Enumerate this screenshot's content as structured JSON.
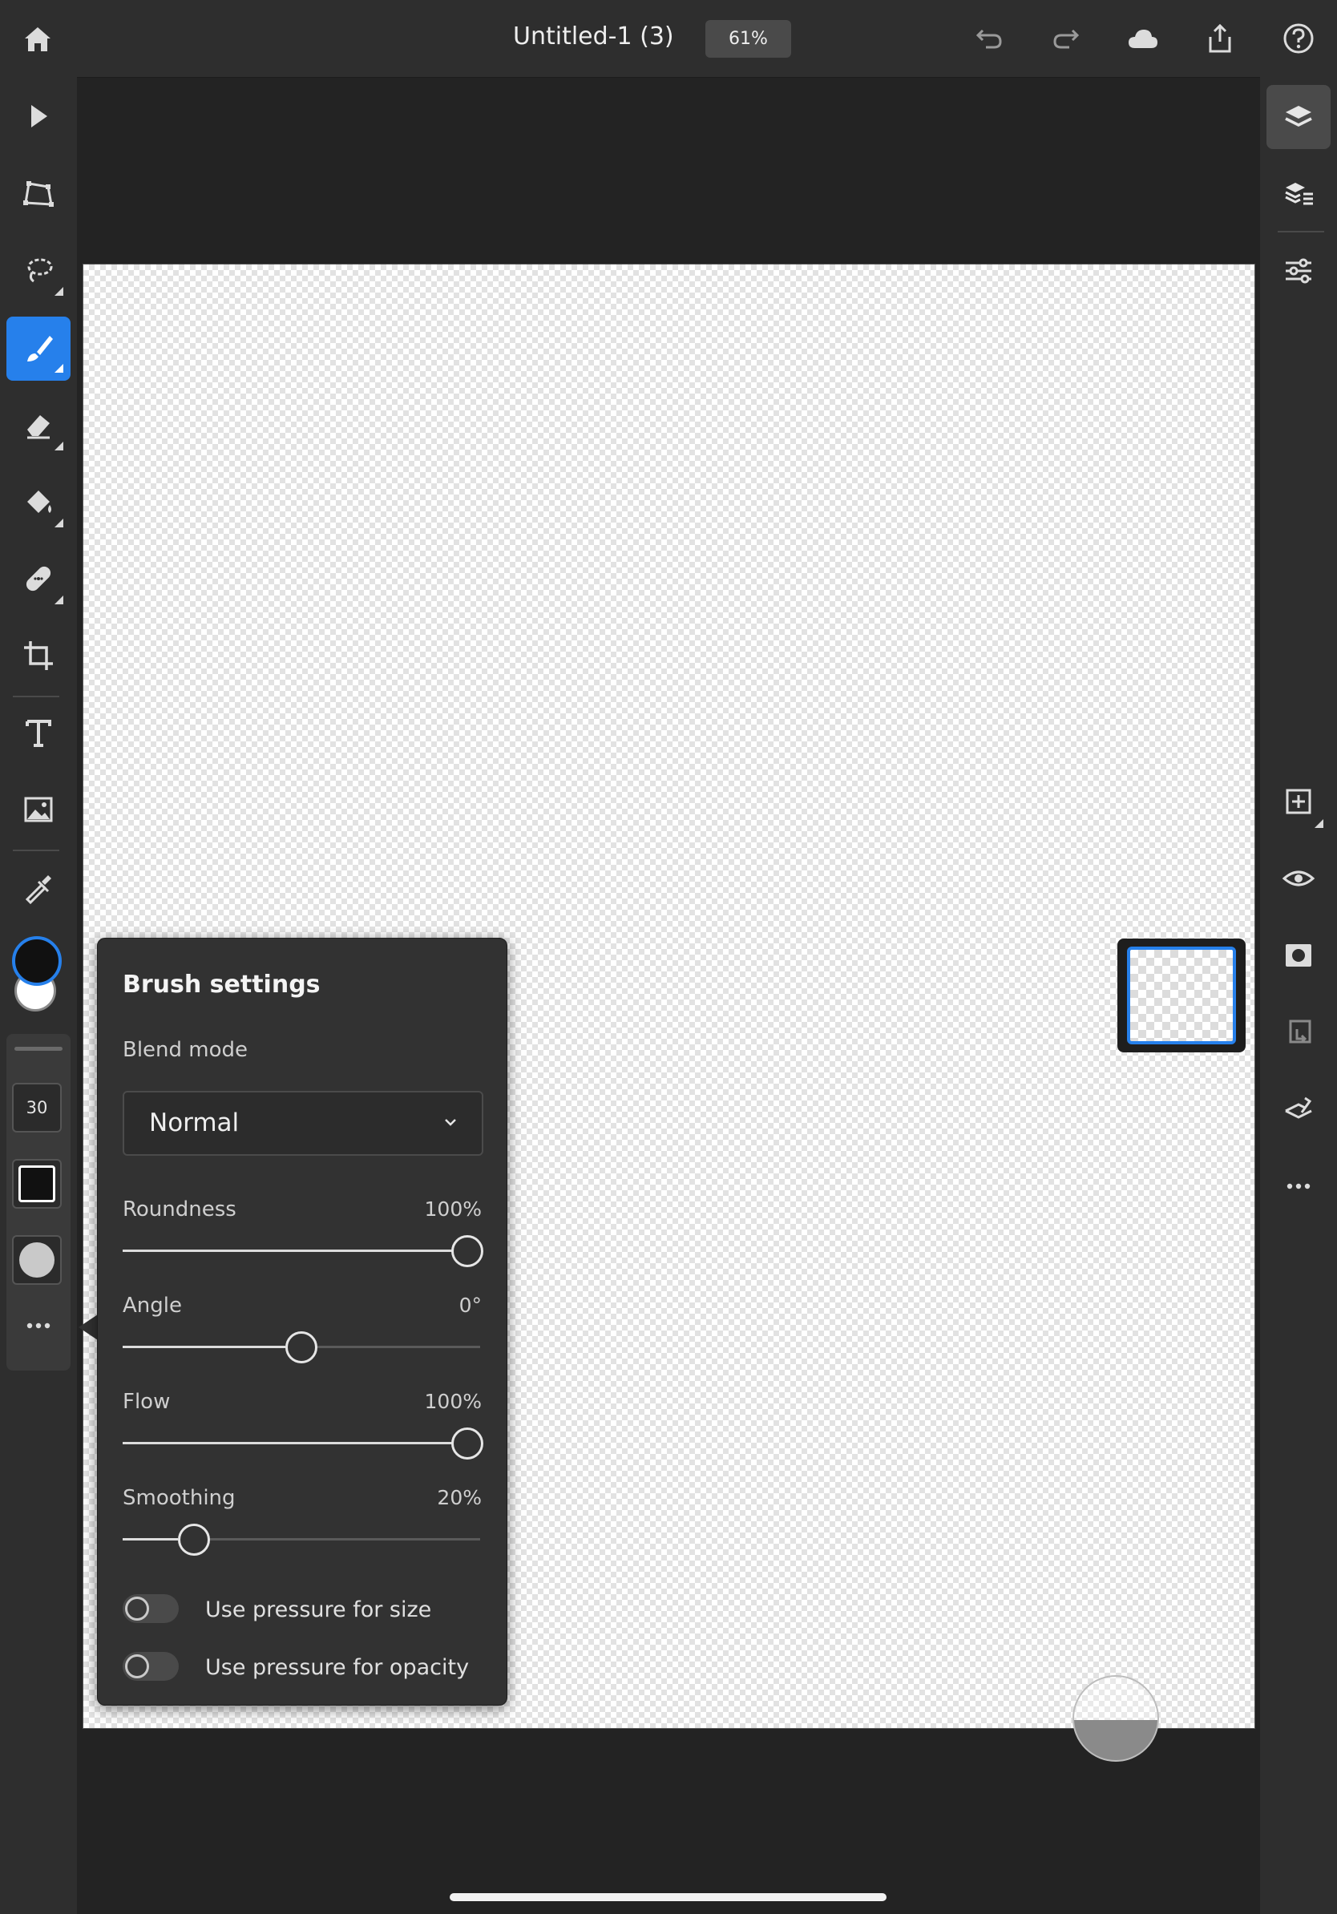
{
  "document": {
    "title": "Untitled-1 (3)",
    "zoom": "61%"
  },
  "topbar": {
    "icons": [
      "home-icon",
      "undo-icon",
      "redo-icon",
      "cloud-icon",
      "share-icon",
      "help-icon"
    ]
  },
  "toolbar": {
    "tools": [
      "select-icon",
      "transform-icon",
      "lasso-icon",
      "brush-icon",
      "eraser-icon",
      "paint-bucket-icon",
      "healing-icon",
      "crop-icon",
      "type-icon",
      "image-icon",
      "eyedropper-icon"
    ],
    "active_tool": "brush",
    "brush_size": "30"
  },
  "colors": {
    "foreground": "#111111",
    "background": "#ffffff",
    "accent": "#2680eb"
  },
  "brush_settings": {
    "title": "Brush settings",
    "blend_mode_label": "Blend mode",
    "blend_mode_value": "Normal",
    "sliders": [
      {
        "label": "Roundness",
        "value_text": "100%",
        "value": 1.0
      },
      {
        "label": "Angle",
        "value_text": "0°",
        "value": 0.5
      },
      {
        "label": "Flow",
        "value_text": "100%",
        "value": 1.0
      },
      {
        "label": "Smoothing",
        "value_text": "20%",
        "value": 0.2
      }
    ],
    "toggles": [
      {
        "label": "Use pressure for size",
        "on": false
      },
      {
        "label": "Use pressure for opacity",
        "on": false
      }
    ]
  },
  "right_panel": {
    "icons": [
      "layers-icon",
      "layer-properties-icon",
      "adjustments-icon",
      "add-layer-icon",
      "visibility-icon",
      "mask-icon",
      "clip-icon",
      "merge-icon",
      "more-icon"
    ]
  }
}
